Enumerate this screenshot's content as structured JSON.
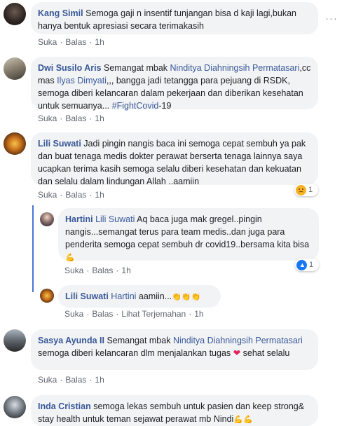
{
  "comments": [
    {
      "name": "Kang Simil",
      "text": "Semoga gaji n insentif tunjangan bisa d kaji lagi,bukan hanya bentuk apresiasi secara terimakasih",
      "actions": {
        "like": "Suka",
        "reply": "Balas",
        "time": "1h"
      },
      "more": "···"
    },
    {
      "name": "Dwi Susilo Aris",
      "text_1": "Semangat mbak",
      "tag_1": "Ninditya Diahningsih Permatasari",
      "text_2": ",cc mas",
      "tag_2": "Ilyas Dimyati",
      "text_3": ",,, bangga jadi tetangga para pejuang di RSDK, semoga diberi kelancaran dalam pekerjaan dan diberikan kesehatan untuk semuanya...",
      "hashtag": "#FightCovid",
      "text_4": "-19",
      "actions": {
        "like": "Suka",
        "reply": "Balas",
        "time": "1h"
      }
    },
    {
      "name": "Lili Suwati",
      "text": "Jadi pingin nangis baca ini semoga cepat sembuh ya pak dan buat tenaga medis dokter perawat berserta tenaga lainnya saya ucapkan terima kasih semoga selalu diberi kesehatan dan kekuatan dan selalu dalam lindungan Allah ..aamiin",
      "reaction": {
        "icon": "sad-reaction-icon",
        "count": "1",
        "color": "#f7b125"
      },
      "actions": {
        "like": "Suka",
        "reply": "Balas",
        "time": "1h"
      }
    },
    {
      "name": "Sasya Ayunda II",
      "text_1": "Semangat mbak",
      "tag_1": "Ninditya Diahningsih Permatasari",
      "text_2": "semoga diberi kelancaran dlm menjalankan tugas",
      "emoji": "❤",
      "text_3": "sehat selalu",
      "actions": {
        "like": "Suka",
        "reply": "Balas",
        "time": "1h"
      }
    },
    {
      "name": "Inda Cristian",
      "text_1": "semoga lekas sembuh untuk pasien dan keep strong& stay health untuk teman sejawat perawat mb Nindi",
      "emoji": "💪💪"
    }
  ],
  "replies": [
    {
      "name": "Hartini",
      "tag": "Lili Suwati",
      "text": "Aq baca juga mak gregel..pingin nangis...semangat terus para team medis..dan juga para penderita semoga cepat sembuh dr covid19..bersama kita bisa",
      "emoji": "💪",
      "reaction": {
        "icon": "like-reaction-icon",
        "count": "1",
        "color": "#1877f2"
      },
      "actions": {
        "like": "Suka",
        "reply": "Balas",
        "time": "1h"
      }
    },
    {
      "name": "Lili Suwati",
      "tag": "Hartini",
      "text": "aamiin...",
      "emoji": "👏👏👏",
      "actions": {
        "like": "Suka",
        "reply": "Balas",
        "translate": "Lihat Terjemahan",
        "time": "1h"
      }
    }
  ],
  "colors": {
    "link": "#385898",
    "bubble": "#f2f3f5",
    "muted": "#606770",
    "thread": "#4a76d6"
  }
}
